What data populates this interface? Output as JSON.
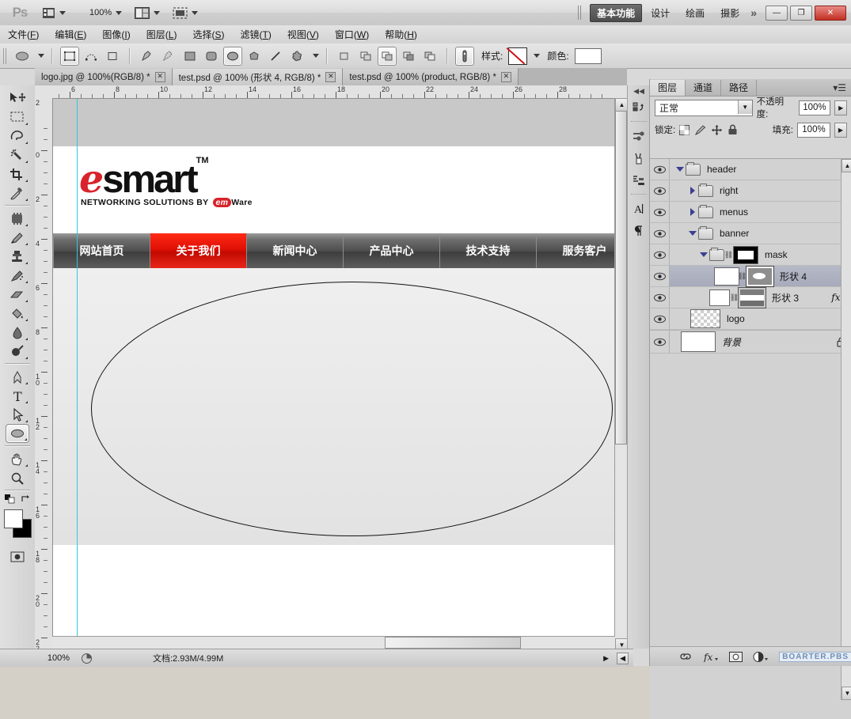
{
  "app": {
    "name": "Ps",
    "zoom_level": "100%"
  },
  "titlebar": {
    "workspaces": [
      {
        "label": "基本功能",
        "active": true
      },
      {
        "label": "设计",
        "active": false
      },
      {
        "label": "绘画",
        "active": false
      },
      {
        "label": "摄影",
        "active": false
      }
    ],
    "more": "»",
    "window_controls": [
      {
        "name": "minimize",
        "glyph": "—"
      },
      {
        "name": "restore",
        "glyph": "❐"
      },
      {
        "name": "close",
        "glyph": "✕"
      }
    ]
  },
  "menubar": {
    "items": [
      {
        "text": "文件",
        "key": "F"
      },
      {
        "text": "编辑",
        "key": "E"
      },
      {
        "text": "图像",
        "key": "I"
      },
      {
        "text": "图层",
        "key": "L"
      },
      {
        "text": "选择",
        "key": "S"
      },
      {
        "text": "滤镜",
        "key": "T"
      },
      {
        "text": "视图",
        "key": "V"
      },
      {
        "text": "窗口",
        "key": "W"
      },
      {
        "text": "帮助",
        "key": "H"
      }
    ]
  },
  "optionsbar": {
    "style_label": "样式:",
    "color_label": "颜色:",
    "color_value": "#ffffff",
    "style_value": "无样式"
  },
  "tabs": [
    {
      "title": "logo.jpg @ 100%(RGB/8) *",
      "active": false
    },
    {
      "title": "test.psd @ 100% (形状 4, RGB/8) *",
      "active": true
    },
    {
      "title": "test.psd @ 100% (product, RGB/8) *",
      "active": false
    }
  ],
  "tools": [
    {
      "name": "move-tool",
      "selected": false
    },
    {
      "name": "marquee-tool",
      "selected": false
    },
    {
      "name": "lasso-tool",
      "selected": false
    },
    {
      "name": "magic-wand-tool",
      "selected": false
    },
    {
      "name": "crop-tool",
      "selected": false
    },
    {
      "name": "eyedropper-tool",
      "selected": false
    },
    {
      "name": "healing-brush-tool",
      "selected": false
    },
    {
      "name": "brush-tool",
      "selected": false
    },
    {
      "name": "clone-stamp-tool",
      "selected": false
    },
    {
      "name": "history-brush-tool",
      "selected": false
    },
    {
      "name": "eraser-tool",
      "selected": false
    },
    {
      "name": "paint-bucket-tool",
      "selected": false
    },
    {
      "name": "blur-tool",
      "selected": false
    },
    {
      "name": "dodge-tool",
      "selected": false
    },
    {
      "name": "pen-tool",
      "selected": false
    },
    {
      "name": "type-tool",
      "selected": false
    },
    {
      "name": "path-selection-tool",
      "selected": false
    },
    {
      "name": "ellipse-shape-tool",
      "selected": true
    },
    {
      "name": "hand-tool",
      "selected": false
    },
    {
      "name": "zoom-tool",
      "selected": false
    }
  ],
  "canvas": {
    "ruler_h_ticks": [
      "6",
      "8",
      "10",
      "12",
      "14",
      "16",
      "18",
      "20",
      "22",
      "24",
      "26",
      "28"
    ],
    "ruler_v_ticks": [
      "2",
      "0",
      "2",
      "4",
      "6",
      "8",
      "10",
      "12",
      "14",
      "16",
      "18",
      "20",
      "22"
    ],
    "website": {
      "logo_e": "e",
      "logo_smart": "smart",
      "logo_tm": "TM",
      "logo_sub_pre": "NETWORKING SOLUTIONS BY ",
      "logo_sub_em": "em",
      "logo_sub_ware": "Ware",
      "nav": [
        {
          "label": "网站首页",
          "active": false
        },
        {
          "label": "关于我们",
          "active": true
        },
        {
          "label": "新闻中心",
          "active": false
        },
        {
          "label": "产品中心",
          "active": false
        },
        {
          "label": "技术支持",
          "active": false
        },
        {
          "label": "服务客户",
          "active": false
        }
      ],
      "active_nav_color": "#e01005"
    }
  },
  "panel": {
    "tabs": [
      {
        "label": "图层",
        "active": true
      },
      {
        "label": "通道",
        "active": false
      },
      {
        "label": "路径",
        "active": false
      }
    ],
    "blend_mode": "正常",
    "opacity_label": "不透明度:",
    "opacity_value": "100%",
    "lock_label": "锁定:",
    "fill_label": "填充:",
    "fill_value": "100%",
    "layers": [
      {
        "name": "header",
        "indent": 0,
        "type": "group",
        "expanded": true,
        "visible": true,
        "selected": false,
        "locked": false,
        "fx": false,
        "linked": false,
        "thumb": "none"
      },
      {
        "name": "right",
        "indent": 1,
        "type": "group",
        "expanded": false,
        "visible": true,
        "selected": false,
        "locked": false,
        "fx": false,
        "linked": false,
        "thumb": "none"
      },
      {
        "name": "menus",
        "indent": 1,
        "type": "group",
        "expanded": false,
        "visible": true,
        "selected": false,
        "locked": false,
        "fx": false,
        "linked": false,
        "thumb": "none"
      },
      {
        "name": "banner",
        "indent": 1,
        "type": "group",
        "expanded": true,
        "visible": true,
        "selected": false,
        "locked": false,
        "fx": false,
        "linked": false,
        "thumb": "none"
      },
      {
        "name": "mask",
        "indent": 2,
        "type": "group",
        "expanded": true,
        "visible": true,
        "selected": false,
        "locked": false,
        "fx": false,
        "linked": true,
        "thumb": "mask"
      },
      {
        "name": "形状 4",
        "indent": 3,
        "type": "shape",
        "expanded": null,
        "visible": true,
        "selected": true,
        "locked": false,
        "fx": false,
        "linked": true,
        "thumb": "sh4"
      },
      {
        "name": "形状 3",
        "indent": 3,
        "type": "shape",
        "expanded": null,
        "visible": true,
        "selected": false,
        "locked": false,
        "fx": true,
        "linked": true,
        "thumb": "sh3"
      },
      {
        "name": "logo",
        "indent": 2,
        "type": "pixel",
        "expanded": null,
        "visible": true,
        "selected": false,
        "locked": false,
        "fx": false,
        "linked": false,
        "thumb": "checker"
      },
      {
        "name": "背景",
        "indent": 1,
        "type": "bg",
        "expanded": null,
        "visible": true,
        "selected": false,
        "locked": true,
        "fx": false,
        "linked": false,
        "thumb": "white"
      }
    ],
    "footer_icons": [
      "link-icon",
      "fx-icon",
      "mask-icon",
      "adjustment-icon"
    ],
    "watermark": "BOARTER.PBS"
  },
  "statusbar": {
    "zoom": "100%",
    "doc_info": "文档:2.93M/4.99M"
  }
}
